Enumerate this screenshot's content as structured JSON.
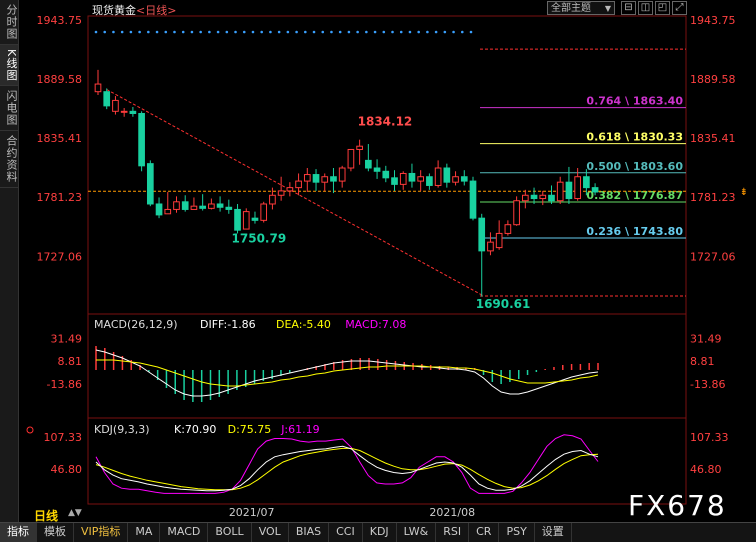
{
  "side_tabs": [
    "分时图",
    "K线图",
    "闪电图",
    "合约资料"
  ],
  "title": "现货黄金",
  "title_sub": "<日线>",
  "theme_select": "全部主题",
  "window_buttons": [
    "⊟",
    "◫",
    "◰",
    "⤢"
  ],
  "period": "日线",
  "period_arrows": "▲▼",
  "watermark": "FX678",
  "bottom_tabs": [
    "指标",
    "模板",
    "VIP指标",
    "MA",
    "MACD",
    "BOLL",
    "VOL",
    "BIAS",
    "CCI",
    "KDJ",
    "LW&",
    "RSI",
    "CR",
    "PSY",
    "设置"
  ],
  "colors": {
    "up": "#ff3b3b",
    "down": "#19d1a0",
    "macd": "#ff00ff",
    "dea": "#ffff00",
    "diff": "#ffffff"
  },
  "chart_data": [
    {
      "type": "candlestick",
      "title": "现货黄金<日线>",
      "y_ticks": [
        "1943.75",
        "1889.58",
        "1835.41",
        "1781.23",
        "1727.06"
      ],
      "x_ticks": [
        "2021/07",
        "2021/08"
      ],
      "current_price": 1781.23,
      "ylim": [
        1690.61,
        1943.75
      ],
      "annotations": [
        {
          "text": "1834.12",
          "value": 1834.12,
          "type": "high"
        },
        {
          "text": "1750.79",
          "value": 1750.79,
          "type": "low"
        },
        {
          "text": "1690.61",
          "value": 1690.61,
          "type": "low"
        }
      ],
      "fibonacci": [
        {
          "label": "0.764 \\ 1863.40",
          "value": 1863.4,
          "color": "#cc33cc"
        },
        {
          "label": "0.618 \\ 1830.33",
          "value": 1830.33,
          "color": "#ffff66"
        },
        {
          "label": "0.500 \\ 1803.60",
          "value": 1803.6,
          "color": "#55bbbb"
        },
        {
          "label": "0.382 \\ 1776.87",
          "value": 1776.87,
          "color": "#66dd66"
        },
        {
          "label": "0.236 \\ 1743.80",
          "value": 1743.8,
          "color": "#66ccee"
        }
      ],
      "candles": [
        {
          "o": 1878,
          "h": 1898,
          "c": 1885,
          "l": 1875
        },
        {
          "o": 1878,
          "h": 1881,
          "c": 1865,
          "l": 1862
        },
        {
          "o": 1860,
          "h": 1874,
          "c": 1870,
          "l": 1857
        },
        {
          "o": 1860,
          "h": 1863,
          "c": 1860,
          "l": 1855
        },
        {
          "o": 1860,
          "h": 1864,
          "c": 1858,
          "l": 1855
        },
        {
          "o": 1858,
          "h": 1860,
          "c": 1810,
          "l": 1805
        },
        {
          "o": 1812,
          "h": 1815,
          "c": 1775,
          "l": 1773
        },
        {
          "o": 1775,
          "h": 1781,
          "c": 1765,
          "l": 1762
        },
        {
          "o": 1766,
          "h": 1786,
          "c": 1770,
          "l": 1766
        },
        {
          "o": 1770,
          "h": 1782,
          "c": 1777,
          "l": 1767
        },
        {
          "o": 1777,
          "h": 1783,
          "c": 1770,
          "l": 1768
        },
        {
          "o": 1770,
          "h": 1781,
          "c": 1773,
          "l": 1770
        },
        {
          "o": 1773,
          "h": 1784,
          "c": 1771,
          "l": 1769
        },
        {
          "o": 1771,
          "h": 1780,
          "c": 1775,
          "l": 1770
        },
        {
          "o": 1775,
          "h": 1782,
          "c": 1772,
          "l": 1768
        },
        {
          "o": 1772,
          "h": 1779,
          "c": 1770,
          "l": 1766
        },
        {
          "o": 1770,
          "h": 1775,
          "c": 1751,
          "l": 1748
        },
        {
          "o": 1752,
          "h": 1771,
          "c": 1768,
          "l": 1752
        },
        {
          "o": 1762,
          "h": 1768,
          "c": 1760,
          "l": 1757
        },
        {
          "o": 1760,
          "h": 1777,
          "c": 1775,
          "l": 1758
        },
        {
          "o": 1775,
          "h": 1790,
          "c": 1783,
          "l": 1770
        },
        {
          "o": 1783,
          "h": 1800,
          "c": 1787,
          "l": 1778
        },
        {
          "o": 1787,
          "h": 1795,
          "c": 1790,
          "l": 1782
        },
        {
          "o": 1790,
          "h": 1803,
          "c": 1796,
          "l": 1783
        },
        {
          "o": 1796,
          "h": 1808,
          "c": 1802,
          "l": 1786
        },
        {
          "o": 1802,
          "h": 1807,
          "c": 1795,
          "l": 1787
        },
        {
          "o": 1795,
          "h": 1803,
          "c": 1800,
          "l": 1787
        },
        {
          "o": 1800,
          "h": 1808,
          "c": 1796,
          "l": 1785
        },
        {
          "o": 1796,
          "h": 1810,
          "c": 1808,
          "l": 1790
        },
        {
          "o": 1808,
          "h": 1822,
          "c": 1825,
          "l": 1805
        },
        {
          "o": 1825,
          "h": 1834,
          "c": 1828,
          "l": 1811
        },
        {
          "o": 1815,
          "h": 1830,
          "c": 1808,
          "l": 1805
        },
        {
          "o": 1808,
          "h": 1816,
          "c": 1805,
          "l": 1798
        },
        {
          "o": 1805,
          "h": 1810,
          "c": 1799,
          "l": 1795
        },
        {
          "o": 1799,
          "h": 1806,
          "c": 1793,
          "l": 1787
        },
        {
          "o": 1793,
          "h": 1805,
          "c": 1803,
          "l": 1788
        },
        {
          "o": 1803,
          "h": 1812,
          "c": 1796,
          "l": 1790
        },
        {
          "o": 1796,
          "h": 1806,
          "c": 1800,
          "l": 1787
        },
        {
          "o": 1800,
          "h": 1803,
          "c": 1792,
          "l": 1788
        },
        {
          "o": 1792,
          "h": 1815,
          "c": 1808,
          "l": 1790
        },
        {
          "o": 1808,
          "h": 1812,
          "c": 1795,
          "l": 1790
        },
        {
          "o": 1795,
          "h": 1805,
          "c": 1800,
          "l": 1792
        },
        {
          "o": 1800,
          "h": 1806,
          "c": 1796,
          "l": 1792
        },
        {
          "o": 1796,
          "h": 1800,
          "c": 1762,
          "l": 1760
        },
        {
          "o": 1762,
          "h": 1766,
          "c": 1732,
          "l": 1690
        },
        {
          "o": 1732,
          "h": 1749,
          "c": 1740,
          "l": 1728
        },
        {
          "o": 1735,
          "h": 1760,
          "c": 1748,
          "l": 1733
        },
        {
          "o": 1748,
          "h": 1760,
          "c": 1756,
          "l": 1746
        },
        {
          "o": 1756,
          "h": 1782,
          "c": 1778,
          "l": 1755
        },
        {
          "o": 1778,
          "h": 1788,
          "c": 1783,
          "l": 1771
        },
        {
          "o": 1783,
          "h": 1790,
          "c": 1780,
          "l": 1775
        },
        {
          "o": 1780,
          "h": 1787,
          "c": 1783,
          "l": 1774
        },
        {
          "o": 1783,
          "h": 1792,
          "c": 1778,
          "l": 1775
        },
        {
          "o": 1778,
          "h": 1800,
          "c": 1795,
          "l": 1775
        },
        {
          "o": 1795,
          "h": 1809,
          "c": 1780,
          "l": 1775
        },
        {
          "o": 1780,
          "h": 1808,
          "c": 1800,
          "l": 1778
        },
        {
          "o": 1800,
          "h": 1807,
          "c": 1790,
          "l": 1783
        },
        {
          "o": 1790,
          "h": 1794,
          "c": 1786,
          "l": 1783
        }
      ]
    },
    {
      "type": "bar",
      "title": "MACD(26,12,9)",
      "legend": [
        {
          "text": "DIFF:-1.86",
          "color": "#ffffff"
        },
        {
          "text": "DEA:-5.40",
          "color": "#ffff00"
        },
        {
          "text": "MACD:7.08",
          "color": "#ff00ff"
        }
      ],
      "y_ticks": [
        "31.49",
        "8.81",
        "-13.86"
      ],
      "ylim": [
        -30,
        40
      ],
      "values": [
        24,
        22,
        18,
        14,
        10,
        5,
        -2,
        -10,
        -18,
        -24,
        -30,
        -32,
        -32,
        -30,
        -27,
        -24,
        -20,
        -17,
        -14,
        -11,
        -9,
        -6,
        -3,
        0,
        2,
        4,
        6,
        8,
        10,
        11,
        12,
        12,
        11,
        10,
        9,
        8,
        7,
        6,
        5,
        4,
        3,
        3,
        2,
        2,
        -5,
        -12,
        -14,
        -12,
        -9,
        -5,
        -2,
        1,
        3,
        5,
        6,
        6,
        7,
        7
      ],
      "diff": [
        20,
        18,
        15,
        12,
        8,
        4,
        -2,
        -8,
        -14,
        -20,
        -24,
        -26,
        -26,
        -25,
        -23,
        -20,
        -17,
        -14,
        -11,
        -9,
        -7,
        -5,
        -3,
        -1,
        1,
        3,
        5,
        7,
        8,
        9,
        9,
        9,
        8,
        7,
        6,
        5,
        4,
        3,
        3,
        2,
        1,
        1,
        0,
        -2,
        -8,
        -16,
        -22,
        -24,
        -24,
        -22,
        -19,
        -16,
        -13,
        -10,
        -7,
        -5,
        -3,
        -2
      ],
      "dea": [
        10,
        10,
        10,
        9,
        8,
        7,
        5,
        3,
        0,
        -3,
        -6,
        -9,
        -12,
        -14,
        -15,
        -16,
        -16,
        -15,
        -14,
        -13,
        -12,
        -10,
        -9,
        -7,
        -6,
        -4,
        -3,
        -1,
        0,
        1,
        2,
        3,
        3,
        4,
        4,
        4,
        4,
        4,
        3,
        3,
        3,
        2,
        2,
        1,
        -1,
        -3,
        -6,
        -9,
        -11,
        -13,
        -13,
        -13,
        -12,
        -11,
        -10,
        -8,
        -7,
        -5
      ]
    },
    {
      "type": "line",
      "title": "KDJ(9,3,3)",
      "legend": [
        {
          "text": "K:70.90",
          "color": "#ffffff"
        },
        {
          "text": "D:75.75",
          "color": "#ffff00"
        },
        {
          "text": "J:61.19",
          "color": "#ff00ff"
        }
      ],
      "y_ticks": [
        "107.33",
        "46.80"
      ],
      "ylim": [
        -5,
        125
      ],
      "k": [
        60,
        45,
        35,
        28,
        25,
        22,
        18,
        15,
        12,
        10,
        8,
        7,
        6,
        5,
        5,
        6,
        8,
        15,
        28,
        45,
        60,
        70,
        74,
        77,
        80,
        82,
        84,
        85,
        88,
        90,
        85,
        72,
        60,
        50,
        44,
        40,
        38,
        40,
        46,
        52,
        58,
        60,
        58,
        50,
        35,
        18,
        10,
        6,
        6,
        8,
        14,
        24,
        38,
        52,
        65,
        75,
        80,
        82,
        75,
        70
      ],
      "d": [
        55,
        50,
        44,
        38,
        33,
        29,
        25,
        22,
        19,
        16,
        13,
        11,
        9,
        8,
        7,
        7,
        7,
        10,
        16,
        26,
        38,
        50,
        60,
        66,
        72,
        76,
        79,
        82,
        84,
        86,
        86,
        82,
        74,
        66,
        58,
        52,
        47,
        45,
        45,
        48,
        52,
        56,
        57,
        54,
        46,
        36,
        27,
        19,
        13,
        10,
        11,
        16,
        24,
        34,
        46,
        57,
        65,
        72,
        74,
        75
      ],
      "j": [
        70,
        40,
        18,
        10,
        8,
        8,
        5,
        2,
        0,
        0,
        0,
        0,
        0,
        0,
        0,
        2,
        8,
        25,
        55,
        85,
        100,
        105,
        105,
        104,
        100,
        98,
        100,
        100,
        102,
        104,
        88,
        60,
        34,
        20,
        18,
        18,
        20,
        30,
        50,
        60,
        70,
        70,
        60,
        40,
        10,
        0,
        0,
        0,
        0,
        4,
        20,
        40,
        65,
        90,
        105,
        112,
        110,
        104,
        82,
        61
      ]
    }
  ]
}
